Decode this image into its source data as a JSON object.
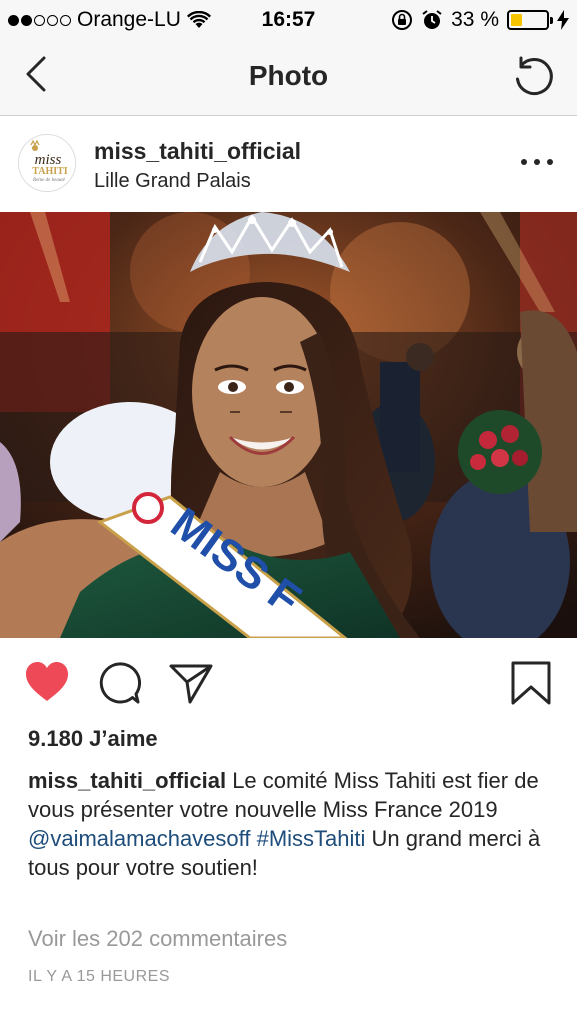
{
  "status_bar": {
    "carrier": "Orange-LU",
    "time": "16:57",
    "battery_percent": "33 %",
    "battery_level": 0.33,
    "signal_bars_filled": 2,
    "signal_bars_total": 5
  },
  "nav": {
    "title": "Photo"
  },
  "post": {
    "username": "miss_tahiti_official",
    "location": "Lille Grand Palais",
    "avatar_logo": {
      "line1": "miss",
      "line2": "TAHITI",
      "line3": "Reine de beauté"
    },
    "photo_text": {
      "sash": "MISS F"
    },
    "likes": "9.180 J’aime",
    "caption": {
      "user": "miss_tahiti_official",
      "text_1": " Le comité Miss Tahiti est fier de vous présenter votre nouvelle Miss France 2019 ",
      "mention": "@vaimalamachavesoff",
      "hashtag": "#MissTahiti",
      "text_2": " Un grand merci à tous pour votre soutien!"
    },
    "comments_link": "Voir les 202 commentaires",
    "time_ago": "IL Y A 15 HEURES"
  },
  "colors": {
    "like_red": "#ed4956",
    "link_blue": "#1e4d7b",
    "muted_gray": "#999999",
    "bar_bg": "#f7f7f7",
    "battery_yellow": "#f5c400"
  },
  "icons": {
    "back": "chevron-left-icon",
    "refresh": "refresh-icon",
    "more": "more-horizontal-icon",
    "like": "heart-icon",
    "comment": "comment-icon",
    "share": "share-icon",
    "save": "bookmark-icon"
  }
}
